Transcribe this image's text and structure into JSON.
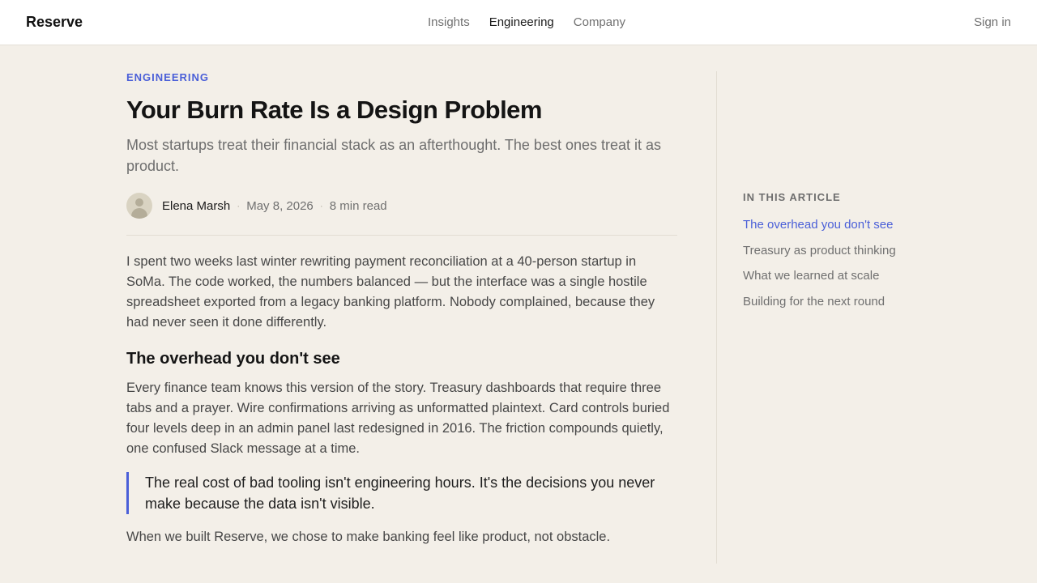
{
  "header": {
    "brand": "Reserve",
    "nav": [
      "Insights",
      "Engineering",
      "Company"
    ],
    "active_nav": "Engineering",
    "signin": "Sign in"
  },
  "article": {
    "category": "ENGINEERING",
    "title": "Your Burn Rate Is a Design Problem",
    "subtitle": "Most startups treat their financial stack as an afterthought. The best ones treat it as product.",
    "author": "Elena Marsh",
    "date": "May 8, 2026",
    "read_time": "8 min read",
    "paragraph1": "I spent two weeks last winter rewriting payment reconciliation at a 40-person startup in SoMa. The code worked, the numbers balanced — but the interface was a single hostile spreadsheet exported from a legacy banking platform. Nobody complained, because they had never seen it done differently.",
    "heading1": "The overhead you don't see",
    "paragraph2": "Every finance team knows this version of the story. Treasury dashboards that require three tabs and a prayer. Wire confirmations arriving as unformatted plaintext. Card controls buried four levels deep in an admin panel last redesigned in 2016. The friction compounds quietly, one confused Slack message at a time.",
    "quote": "The real cost of bad tooling isn't engineering hours. It's the decisions you never make because the data isn't visible.",
    "paragraph3": "When we built Reserve, we chose to make banking feel like product, not obstacle."
  },
  "toc": {
    "title": "IN THIS ARTICLE",
    "items": [
      "The overhead you don't see",
      "Treasury as product thinking",
      "What we learned at scale",
      "Building for the next round"
    ],
    "active_item": "The overhead you don't see"
  },
  "colors": {
    "accent": "#4a5fd8",
    "background": "#f3efe8",
    "header_bg": "#ffffff"
  }
}
